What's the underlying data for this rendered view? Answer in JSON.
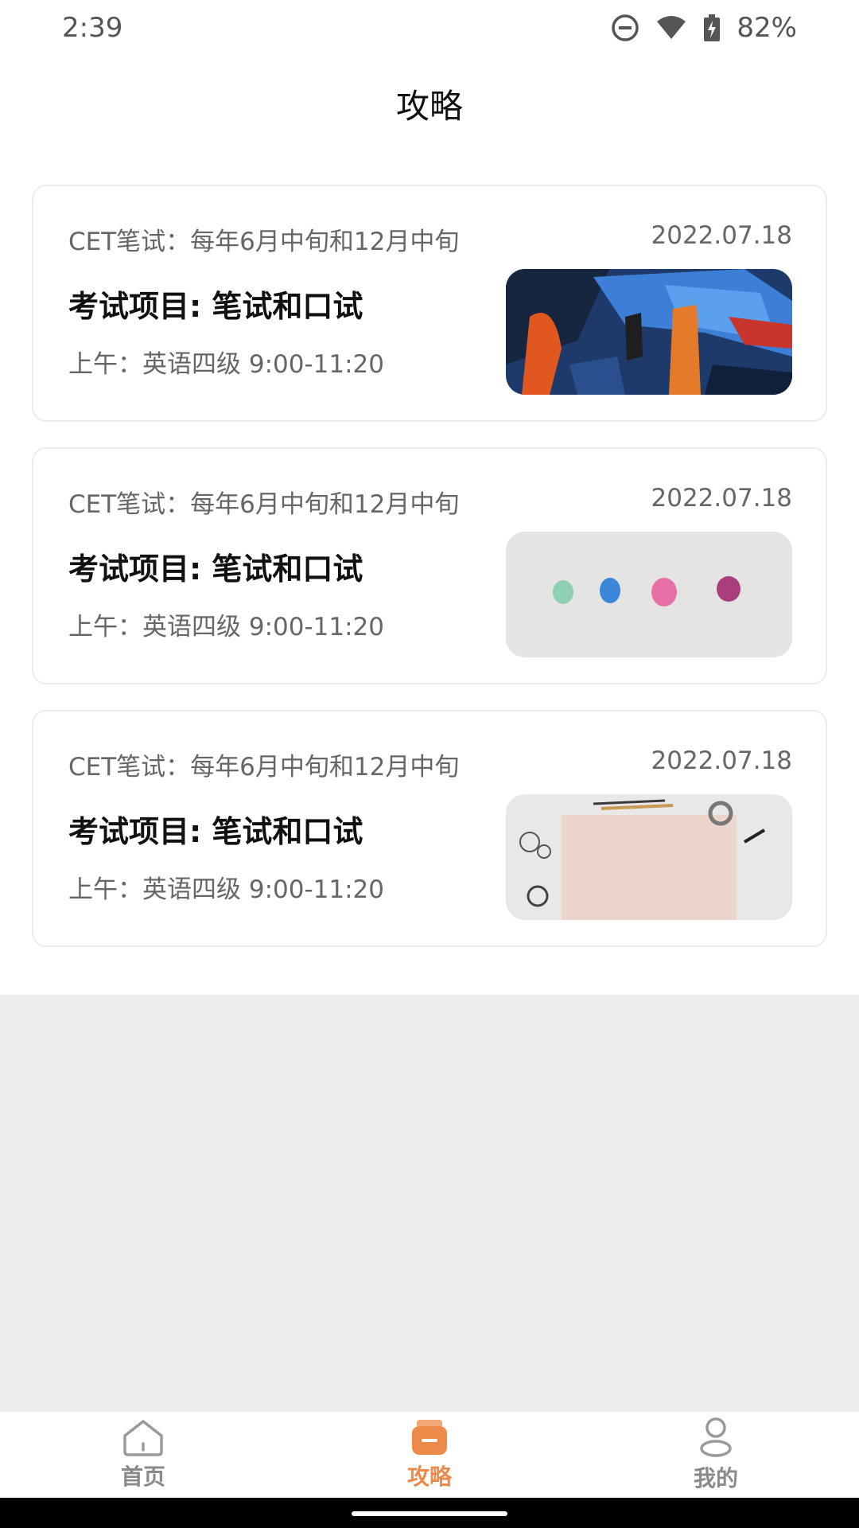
{
  "status_bar": {
    "time": "2:39",
    "battery": "82%",
    "icons": [
      "do-not-disturb-icon",
      "wifi-icon",
      "battery-charging-icon"
    ]
  },
  "header": {
    "title": "攻略"
  },
  "cards": [
    {
      "schedule": "CET笔试：每年6月中旬和12月中旬",
      "date": "2022.07.18",
      "title": "考试项目: 笔试和口试",
      "subtitle": "上午：英语四级 9:00-11:20",
      "image": "abstract-painting"
    },
    {
      "schedule": "CET笔试：每年6月中旬和12月中旬",
      "date": "2022.07.18",
      "title": "考试项目: 笔试和口试",
      "subtitle": "上午：英语四级 9:00-11:20",
      "image": "paint-dots"
    },
    {
      "schedule": "CET笔试：每年6月中旬和12月中旬",
      "date": "2022.07.18",
      "title": "考试项目: 笔试和口试",
      "subtitle": "上午：英语四级 9:00-11:20",
      "image": "paper-on-desk"
    }
  ],
  "tabs": [
    {
      "label": "首页",
      "icon": "home-icon",
      "active": false
    },
    {
      "label": "攻略",
      "icon": "guide-icon",
      "active": true
    },
    {
      "label": "我的",
      "icon": "user-icon",
      "active": false
    }
  ],
  "colors": {
    "accent": "#ec8a49",
    "inactive": "#8a8a8a",
    "background_gray": "#eeeeee"
  }
}
